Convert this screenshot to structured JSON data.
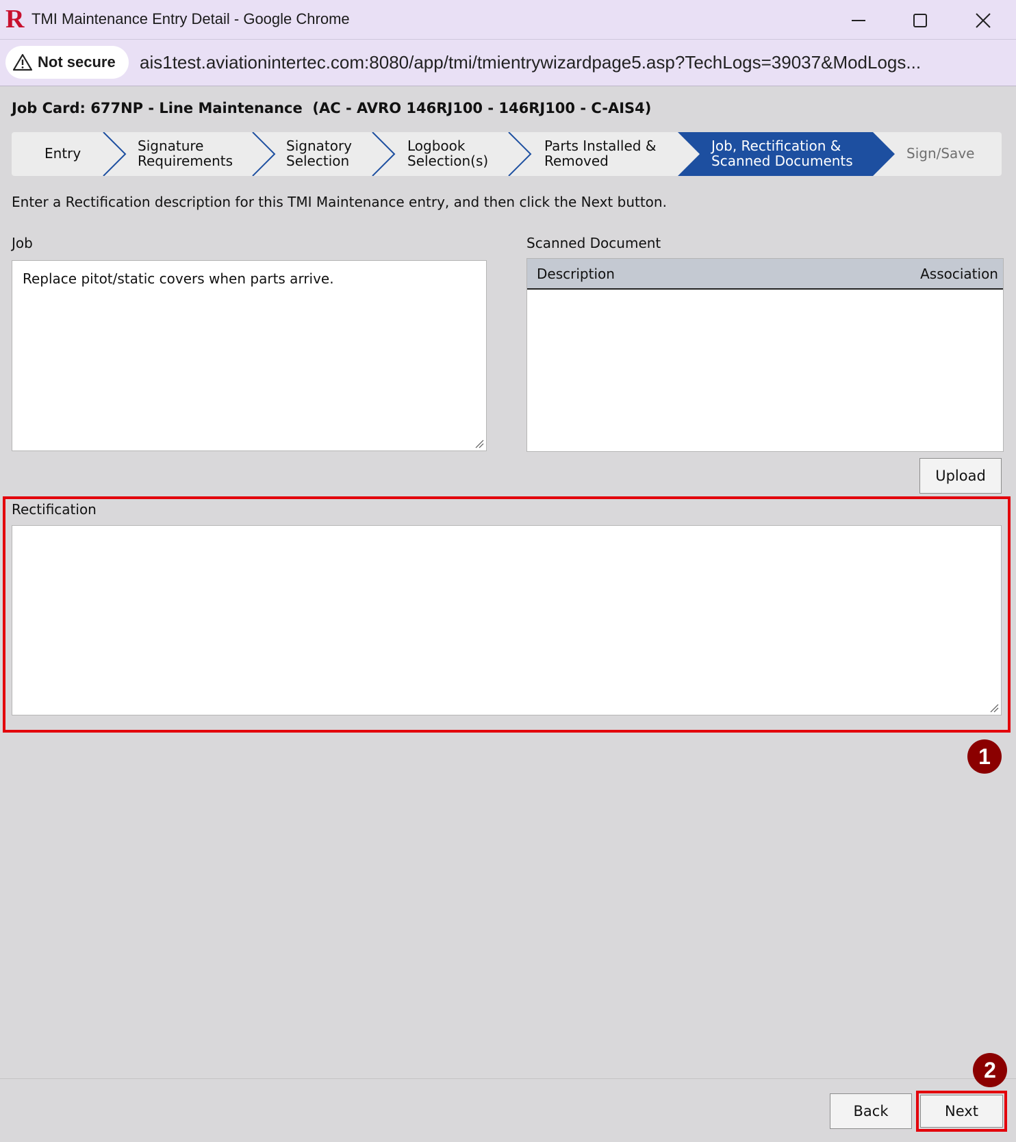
{
  "window": {
    "title": "TMI Maintenance Entry Detail - Google Chrome"
  },
  "addressbar": {
    "security_label": "Not secure",
    "url": "ais1test.aviationintertec.com:8080/app/tmi/tmientrywizardpage5.asp?TechLogs=39037&ModLogs..."
  },
  "page": {
    "heading": "Job Card: 677NP - Line Maintenance  (AC - AVRO 146RJ100 - 146RJ100 - C-AIS4)",
    "instructions": "Enter a Rectification description for this TMI Maintenance entry, and then click the Next button."
  },
  "wizard": {
    "steps": [
      {
        "line1": "Entry",
        "line2": "",
        "state": "done"
      },
      {
        "line1": "Signature",
        "line2": "Requirements",
        "state": "done"
      },
      {
        "line1": "Signatory",
        "line2": "Selection",
        "state": "done"
      },
      {
        "line1": "Logbook",
        "line2": "Selection(s)",
        "state": "done"
      },
      {
        "line1": "Parts Installed &",
        "line2": "Removed",
        "state": "done"
      },
      {
        "line1": "Job, Rectification &",
        "line2": "Scanned Documents",
        "state": "active"
      },
      {
        "line1": "Sign/Save",
        "line2": "",
        "state": "disabled"
      }
    ],
    "active_color": "#1d4fa0"
  },
  "job": {
    "label": "Job",
    "value": "Replace pitot/static covers when parts arrive."
  },
  "scanned": {
    "label": "Scanned Document",
    "columns": [
      "Description",
      "Association"
    ],
    "rows": []
  },
  "buttons": {
    "upload": "Upload",
    "back": "Back",
    "next": "Next"
  },
  "rectification": {
    "label": "Rectification",
    "value": ""
  },
  "annotations": {
    "badge_1": "1",
    "badge_2": "2",
    "highlight_color": "#e3000b"
  }
}
